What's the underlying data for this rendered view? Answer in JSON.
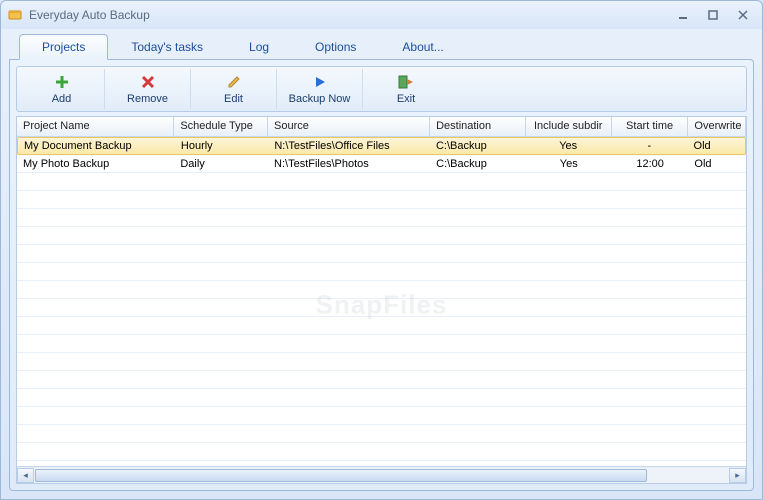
{
  "window": {
    "title": "Everyday Auto Backup"
  },
  "tabs": [
    {
      "label": "Projects",
      "active": true
    },
    {
      "label": "Today's tasks",
      "active": false
    },
    {
      "label": "Log",
      "active": false
    },
    {
      "label": "Options",
      "active": false
    },
    {
      "label": "About...",
      "active": false
    }
  ],
  "toolbar": {
    "add": "Add",
    "remove": "Remove",
    "edit": "Edit",
    "backup_now": "Backup Now",
    "exit": "Exit"
  },
  "grid": {
    "columns": {
      "project_name": "Project Name",
      "schedule_type": "Schedule Type",
      "source": "Source",
      "destination": "Destination",
      "include_subdir": "Include subdir",
      "start_time": "Start time",
      "overwrite": "Overwrite"
    },
    "rows": [
      {
        "project_name": "My Document Backup",
        "schedule_type": "Hourly",
        "source": "N:\\TestFiles\\Office Files",
        "destination": "C:\\Backup",
        "include_subdir": "Yes",
        "start_time": "-",
        "overwrite": "Old",
        "selected": true
      },
      {
        "project_name": "My Photo Backup",
        "schedule_type": "Daily",
        "source": "N:\\TestFiles\\Photos",
        "destination": "C:\\Backup",
        "include_subdir": "Yes",
        "start_time": "12:00",
        "overwrite": "Old",
        "selected": false
      }
    ]
  },
  "watermark": "SnapFiles"
}
